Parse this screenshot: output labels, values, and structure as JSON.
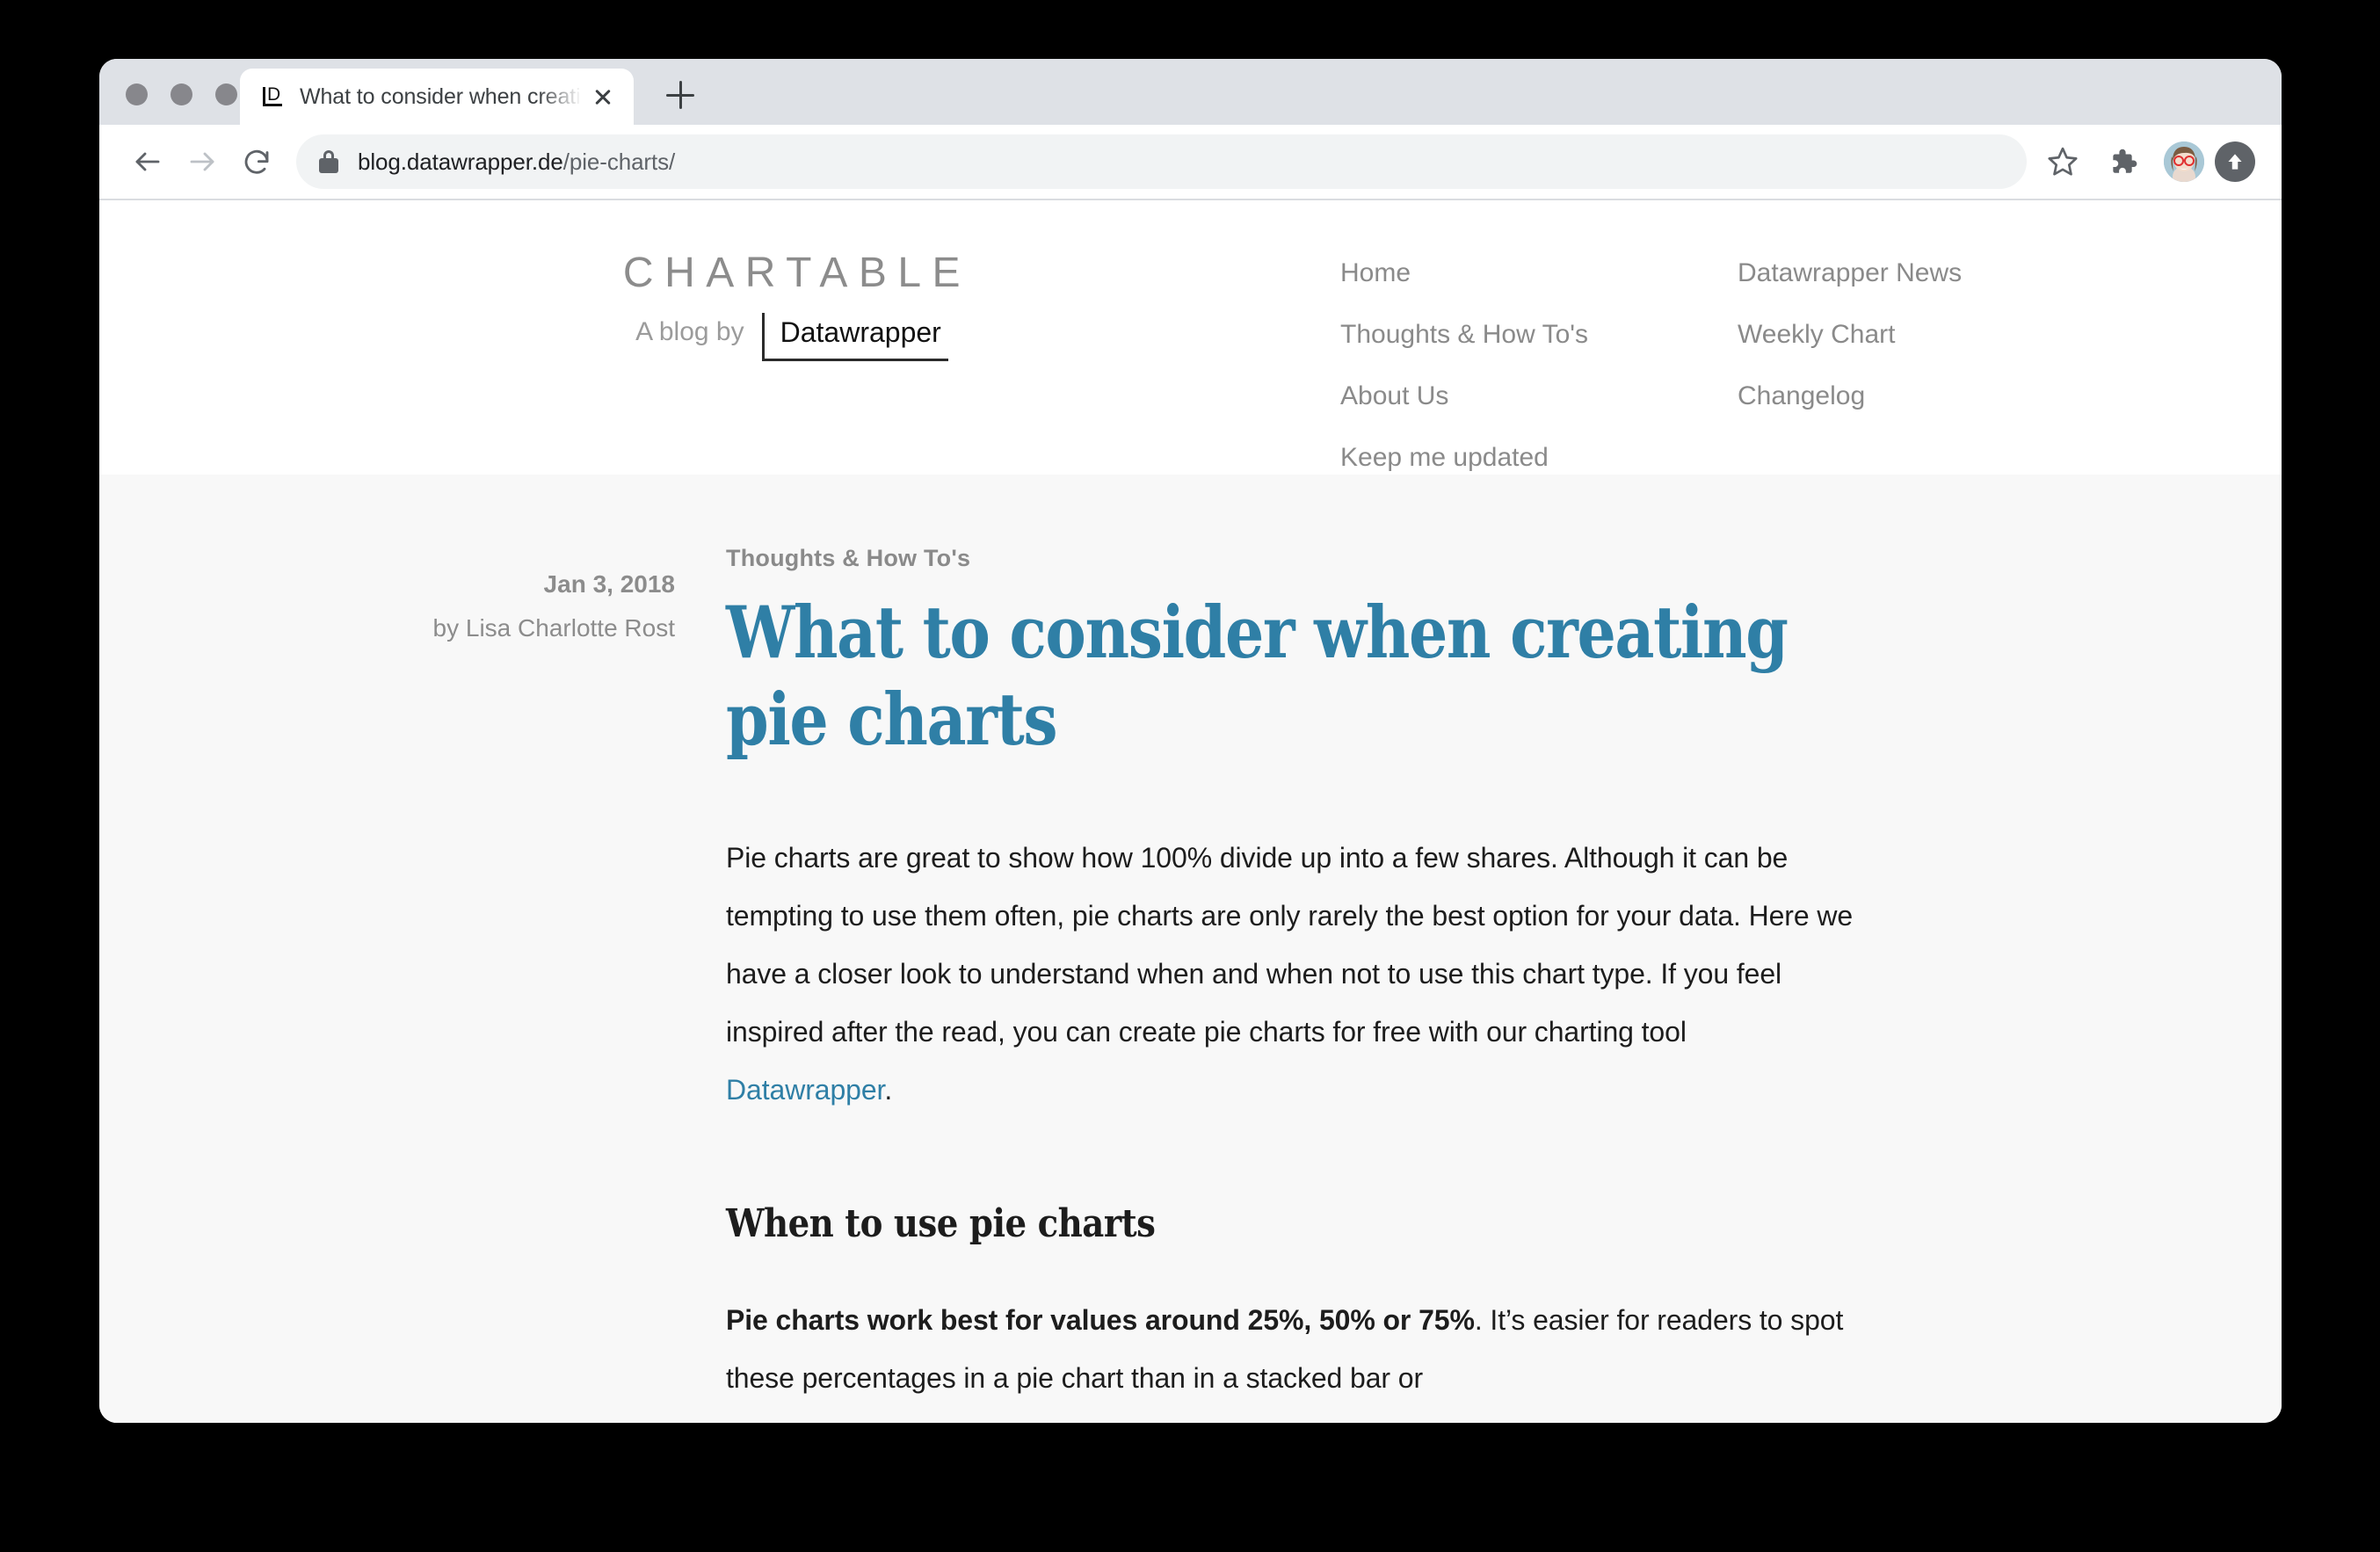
{
  "browser": {
    "tab": {
      "title": "What to consider when creating",
      "favicon_letter": "D",
      "close_label": "×"
    },
    "new_tab_label": "+",
    "toolbar": {
      "back_label": "←",
      "forward_label": "→",
      "reload_label": "↻",
      "url_host": "blog.datawrapper.de",
      "url_path": "/pie-charts/",
      "lock_label": "secure",
      "star_label": "Bookmark this page",
      "extensions_label": "Extensions",
      "profile_label": "Profile",
      "update_label": "Update available"
    }
  },
  "site": {
    "brand": {
      "title": "CHARTABLE",
      "subtitle_pre": "A blog by",
      "subtitle_name": "Datawrapper"
    },
    "nav": {
      "column_one": [
        "Home",
        "Thoughts & How To's",
        "About Us",
        "Keep me updated"
      ],
      "column_two": [
        "Datawrapper News",
        "Weekly Chart",
        "Changelog"
      ]
    }
  },
  "article": {
    "date": "Jan 3, 2018",
    "author": "by Lisa Charlotte Rost",
    "category": "Thoughts & How To's",
    "headline": "What to consider when creating pie charts",
    "intro_before_link": "Pie charts are great to show how 100% divide up into a few shares. Although it can be tempting to use them often, pie charts are only rarely the best option for your data. Here we have a closer look to understand when and when not to use this chart type. If you feel inspired after the read, you can create pie charts for free with our charting tool ",
    "intro_link": "Datawrapper",
    "intro_after_link": ".",
    "section_heading": "When to use pie charts",
    "section_bold": "Pie charts work best for values around 25%, 50% or 75%",
    "section_rest": ". It’s easier for readers to spot these percentages in a pie chart than in a stacked bar or"
  },
  "colors": {
    "accent": "#2f7fa6",
    "tab_strip": "#dee1e6",
    "page_bg": "#f8f8f8",
    "muted_text": "#8a8a8a"
  }
}
